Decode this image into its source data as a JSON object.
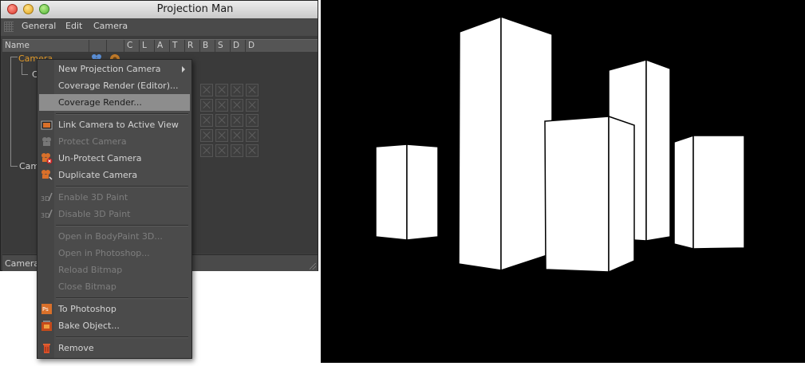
{
  "window": {
    "title": "Projection Man"
  },
  "menubar": {
    "items": [
      "General",
      "Edit",
      "Camera"
    ]
  },
  "columns": {
    "name": "Name",
    "flags": [
      "C",
      "L",
      "A",
      "T",
      "R",
      "B",
      "S",
      "D",
      "D"
    ]
  },
  "tree": {
    "camera_label": "Camera",
    "child_label": "C",
    "camera2_label": "Cam"
  },
  "status": {
    "text": "Camera"
  },
  "context_menu": {
    "items": [
      {
        "label": "New Projection Camera",
        "enabled": true,
        "submenu": true
      },
      {
        "label": "Coverage Render (Editor)...",
        "enabled": true
      },
      {
        "label": "Coverage Render...",
        "enabled": true,
        "highlighted": true
      },
      {
        "label": "Link Camera to Active View",
        "enabled": true,
        "icon": "link-camera-icon"
      },
      {
        "label": "Protect Camera",
        "enabled": false,
        "icon": "protect-camera-icon"
      },
      {
        "label": "Un-Protect Camera",
        "enabled": true,
        "icon": "unprotect-camera-icon"
      },
      {
        "label": "Duplicate Camera",
        "enabled": true,
        "icon": "duplicate-camera-icon"
      },
      {
        "label": "Enable 3D Paint",
        "enabled": false,
        "icon": "enable-3d-paint-icon"
      },
      {
        "label": "Disable 3D Paint",
        "enabled": false,
        "icon": "disable-3d-paint-icon"
      },
      {
        "label": "Open in BodyPaint 3D...",
        "enabled": false
      },
      {
        "label": "Open in Photoshop...",
        "enabled": false
      },
      {
        "label": "Reload Bitmap",
        "enabled": false
      },
      {
        "label": "Close Bitmap",
        "enabled": false
      },
      {
        "label": "To Photoshop",
        "enabled": true,
        "icon": "photoshop-icon"
      },
      {
        "label": "Bake Object...",
        "enabled": true,
        "icon": "bake-object-icon"
      },
      {
        "label": "Remove",
        "enabled": true,
        "icon": "trash-icon"
      }
    ]
  },
  "colors": {
    "camera_text": "#e39b2a",
    "viewport_bg": "#000000",
    "building": "#ffffff"
  }
}
